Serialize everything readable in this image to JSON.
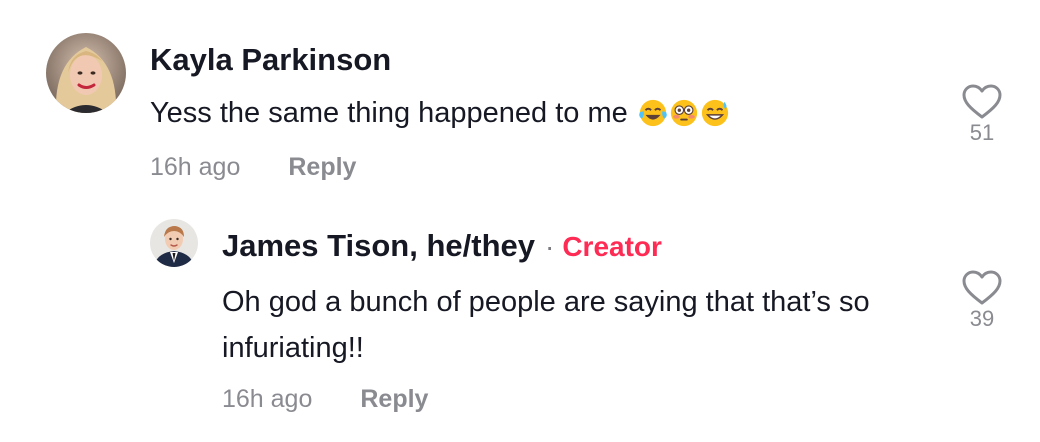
{
  "comments": [
    {
      "username": "Kayla Parkinson",
      "text": "Yess the same thing happened to me",
      "emojis": [
        "tears-of-joy-emoji",
        "flushed-face-emoji",
        "grinning-sweat-emoji"
      ],
      "timestamp": "16h ago",
      "reply_label": "Reply",
      "likes": "51"
    },
    {
      "username": "James Tison, he/they",
      "separator": "·",
      "badge": "Creator",
      "text": "Oh god a bunch of people are saying that that’s so infuriating!!",
      "timestamp": "16h ago",
      "reply_label": "Reply",
      "likes": "39"
    }
  ],
  "colors": {
    "text": "#161823",
    "muted": "#8a8b91",
    "creator_accent": "#fe2c55"
  }
}
